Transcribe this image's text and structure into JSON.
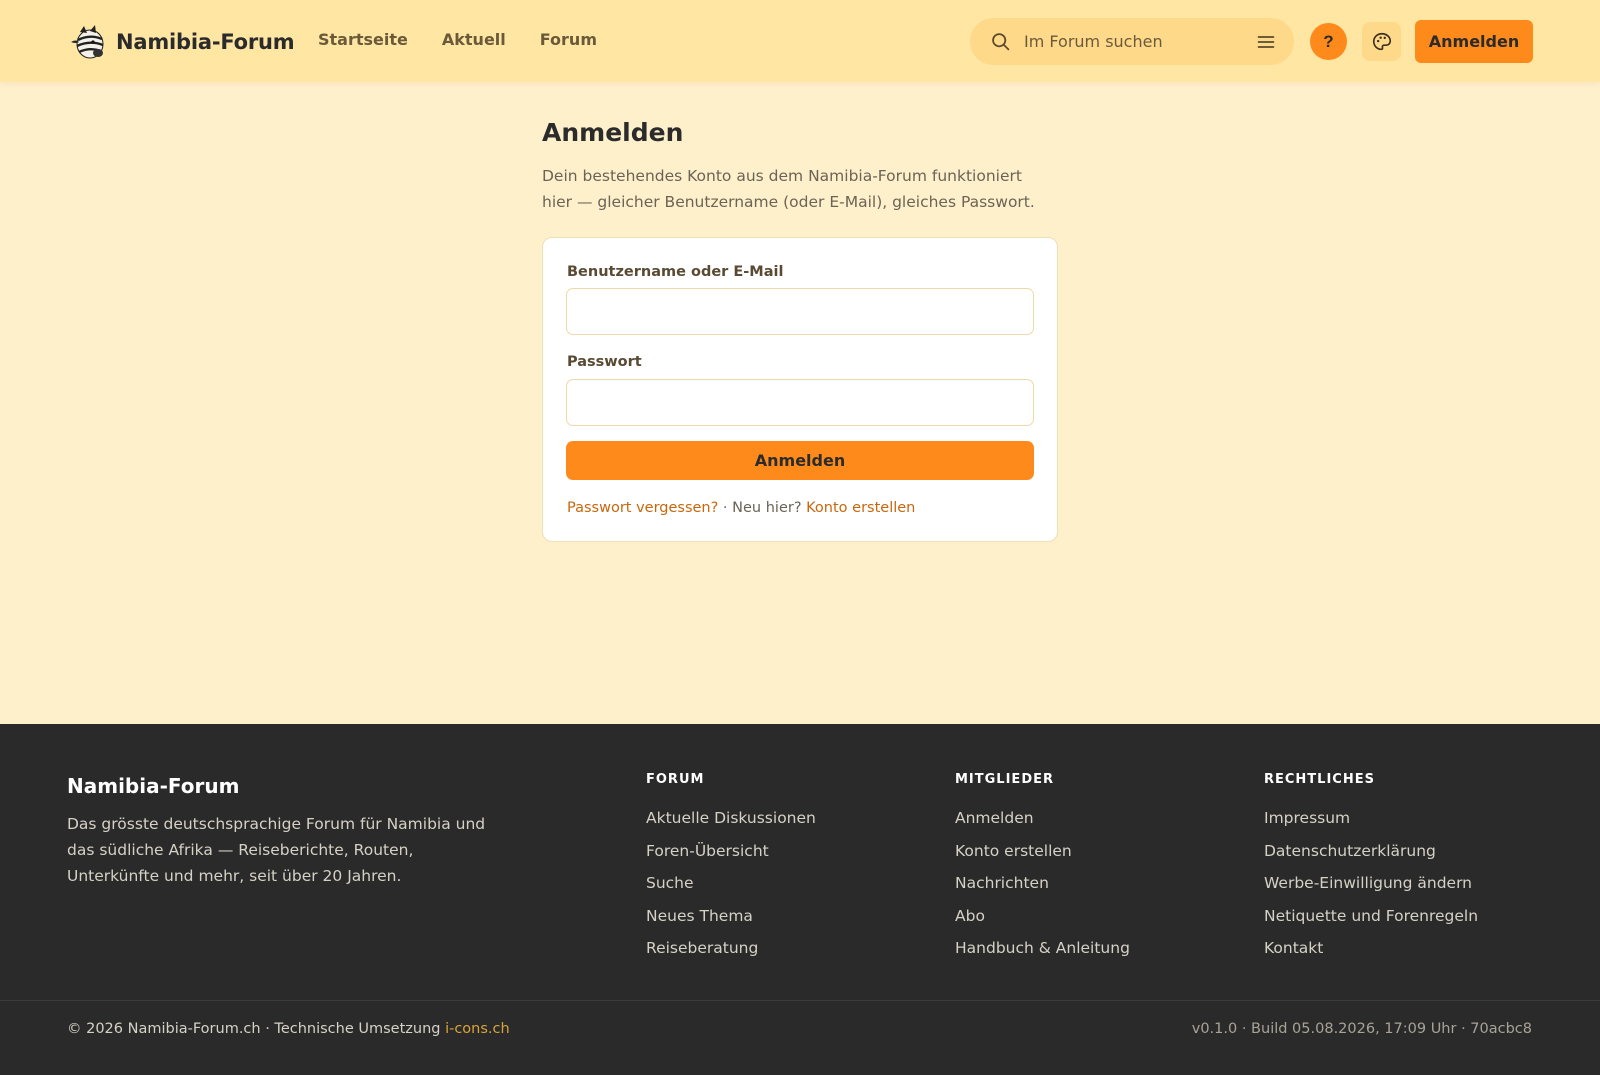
{
  "header": {
    "brand": "Namibia-Forum",
    "nav": [
      "Startseite",
      "Aktuell",
      "Forum"
    ],
    "search_placeholder": "Im Forum suchen",
    "help_label": "?",
    "login_label": "Anmelden"
  },
  "icons": {
    "logo": "zebra-logo-icon",
    "search": "search-icon",
    "menu": "hamburger-menu-icon",
    "theme": "palette-icon"
  },
  "colors": {
    "accent": "#ff8a1c",
    "header_bg": "#ffe6a3",
    "page_bg": "#fff0cc",
    "footer_bg": "#2a2a2a",
    "link": "#c8680d"
  },
  "main": {
    "title": "Anmelden",
    "description": "Dein bestehendes Konto aus dem Namibia-Forum funktioniert hier — gleicher Benutzername (oder E-Mail), gleiches Passwort.",
    "form": {
      "username_label": "Benutzername oder E-Mail",
      "username_value": "",
      "password_label": "Passwort",
      "password_value": "",
      "submit_label": "Anmelden",
      "forgot_link": "Passwort vergessen?",
      "separator": " · Neu hier? ",
      "register_link": "Konto erstellen"
    }
  },
  "footer": {
    "brand": "Namibia-Forum",
    "description": "Das grösste deutschsprachige Forum für Namibia und das südliche Afrika — Reiseberichte, Routen, Unterkünfte und mehr, seit über 20 Jahren.",
    "columns": [
      {
        "title": "FORUM",
        "links": [
          "Aktuelle Diskussionen",
          "Foren-Übersicht",
          "Suche",
          "Neues Thema",
          "Reiseberatung"
        ]
      },
      {
        "title": "MITGLIEDER",
        "links": [
          "Anmelden",
          "Konto erstellen",
          "Nachrichten",
          "Abo",
          "Handbuch & Anleitung"
        ]
      },
      {
        "title": "RECHTLICHES",
        "links": [
          "Impressum",
          "Datenschutzerklärung",
          "Werbe-Einwilligung ändern",
          "Netiquette und Forenregeln",
          "Kontakt"
        ]
      }
    ],
    "copyright": "© 2026 Namibia-Forum.ch · Technische Umsetzung ",
    "credit_link": "i-cons.ch",
    "version": "v0.1.0 · Build 05.08.2026, 17:09 Uhr · 70acbc8"
  }
}
